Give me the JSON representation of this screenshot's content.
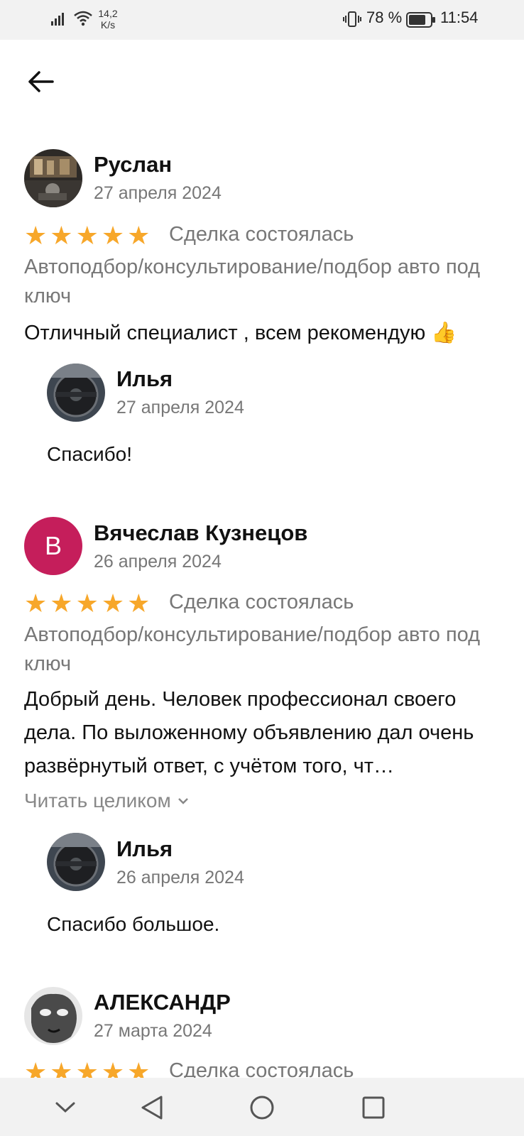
{
  "status_bar": {
    "speed": "14,2 K/s",
    "battery": "78 %",
    "time": "11:54"
  },
  "reviews": [
    {
      "name": "Руслан",
      "date": "27 апреля 2024",
      "stars": 5,
      "deal": "Сделка состоялась",
      "service": "Автоподбор/консультирование/подбор авто под ключ",
      "text": "Отличный специалист ,  всем рекомендую 👍",
      "reply": {
        "name": "Илья",
        "date": "27 апреля 2024",
        "text": "Спасибо!"
      }
    },
    {
      "name": "Вячеслав Кузнецов",
      "avatar_letter": "В",
      "date": "26 апреля 2024",
      "stars": 5,
      "deal": "Сделка состоялась",
      "service": "Автоподбор/консультирование/подбор авто под ключ",
      "text": "Добрый день. Человек профессионал своего дела. По выложенному объявлению дал очень развёрнутый ответ, с учётом того, чт…",
      "read_more": "Читать целиком",
      "reply": {
        "name": "Илья",
        "date": "26 апреля 2024",
        "text": "Спасибо большое."
      }
    },
    {
      "name": "АЛЕКСАНДР",
      "date": "27 марта 2024",
      "stars": 5,
      "deal": "Сделка состоялась"
    }
  ],
  "colors": {
    "star": "#f7a72a",
    "avatar_bg": "#c51e5b"
  }
}
